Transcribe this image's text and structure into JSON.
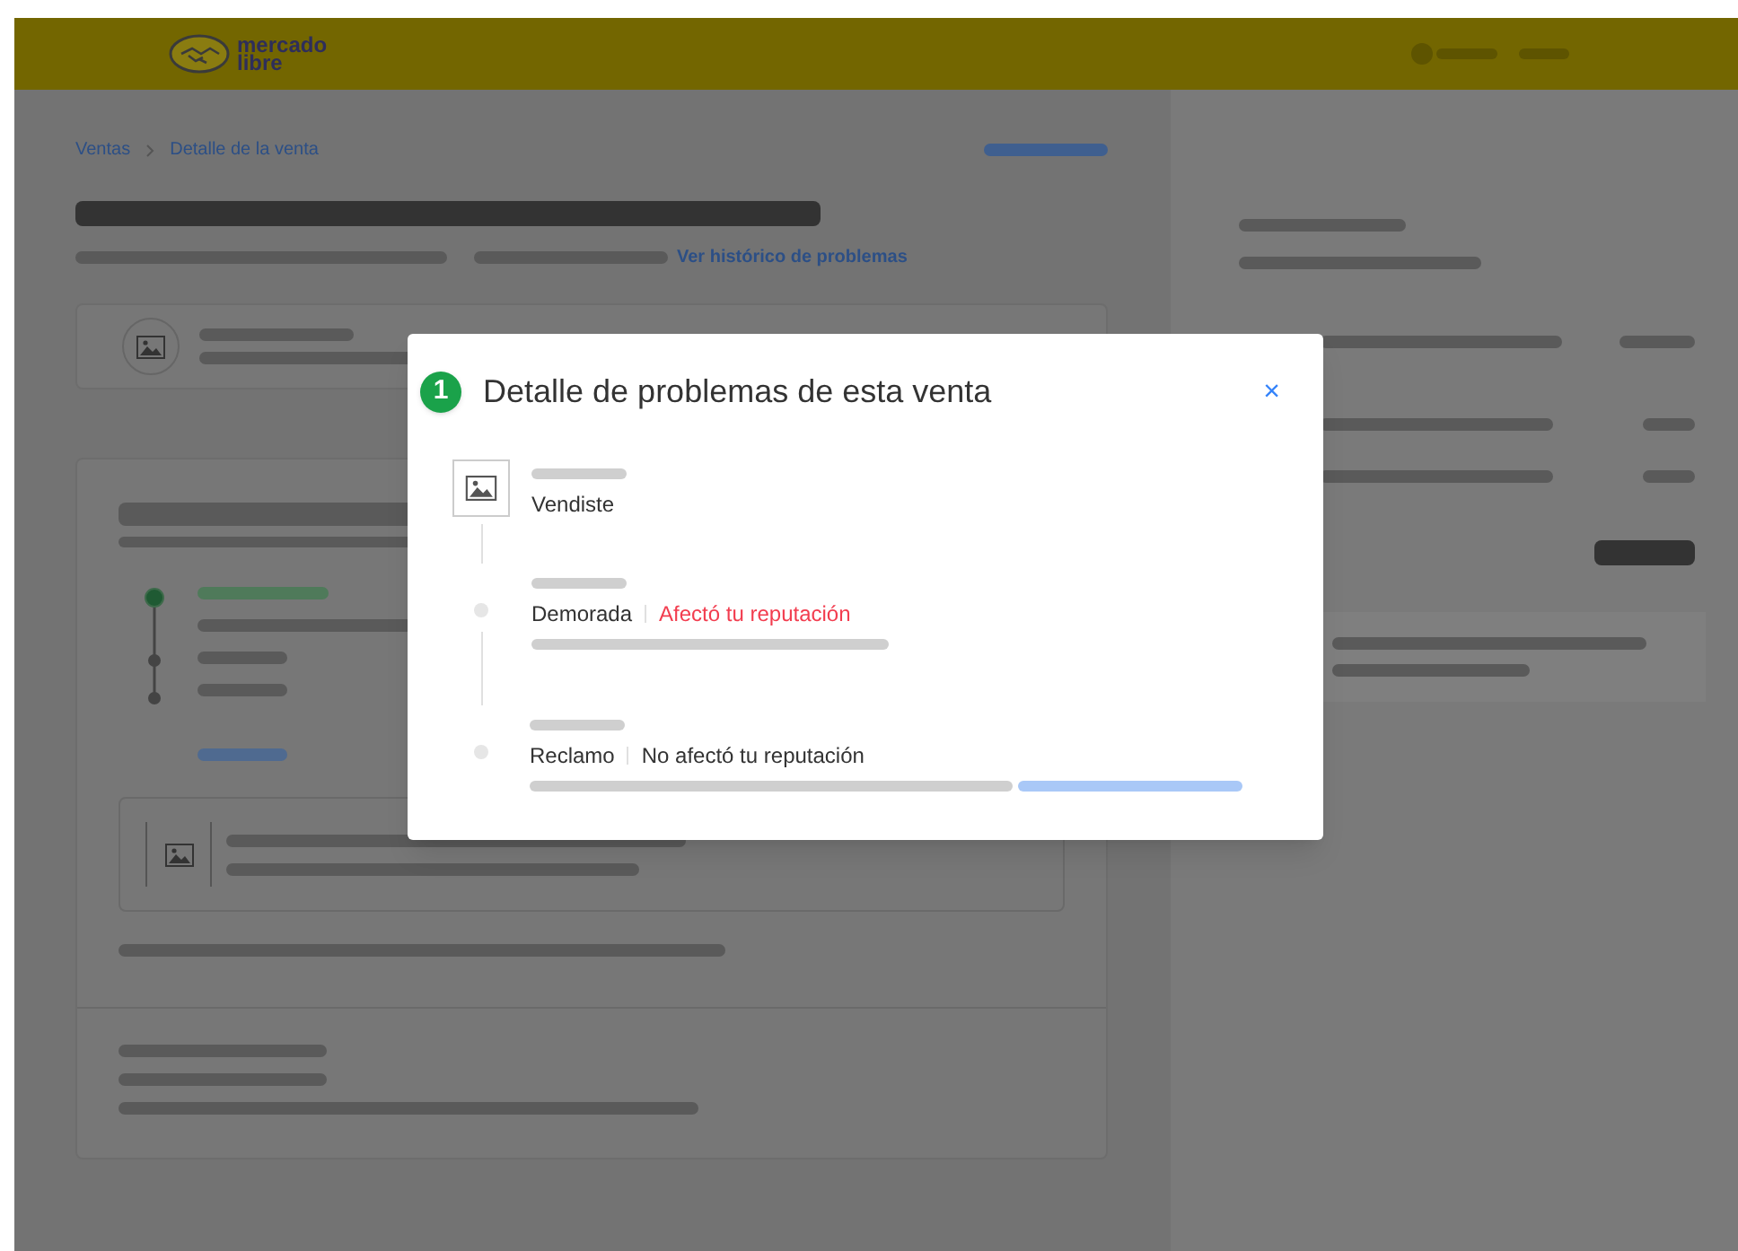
{
  "header": {
    "logo": [
      "mercado",
      "libre"
    ]
  },
  "breadcrumb": [
    "Ventas",
    "Detalle de la venta"
  ],
  "history_link": "Ver histórico de problemas",
  "modal": {
    "badge": "1",
    "title": "Detalle de problemas de esta venta",
    "close": "×",
    "events": [
      {
        "kind": "sale",
        "label": "Vendiste"
      },
      {
        "kind": "problem",
        "label": "Demorada",
        "impact": "Afectó tu reputación",
        "affects_reputation": true,
        "link": false
      },
      {
        "kind": "problem",
        "label": "Reclamo",
        "impact": "No afectó tu reputación",
        "affects_reputation": false,
        "link": true
      }
    ]
  }
}
